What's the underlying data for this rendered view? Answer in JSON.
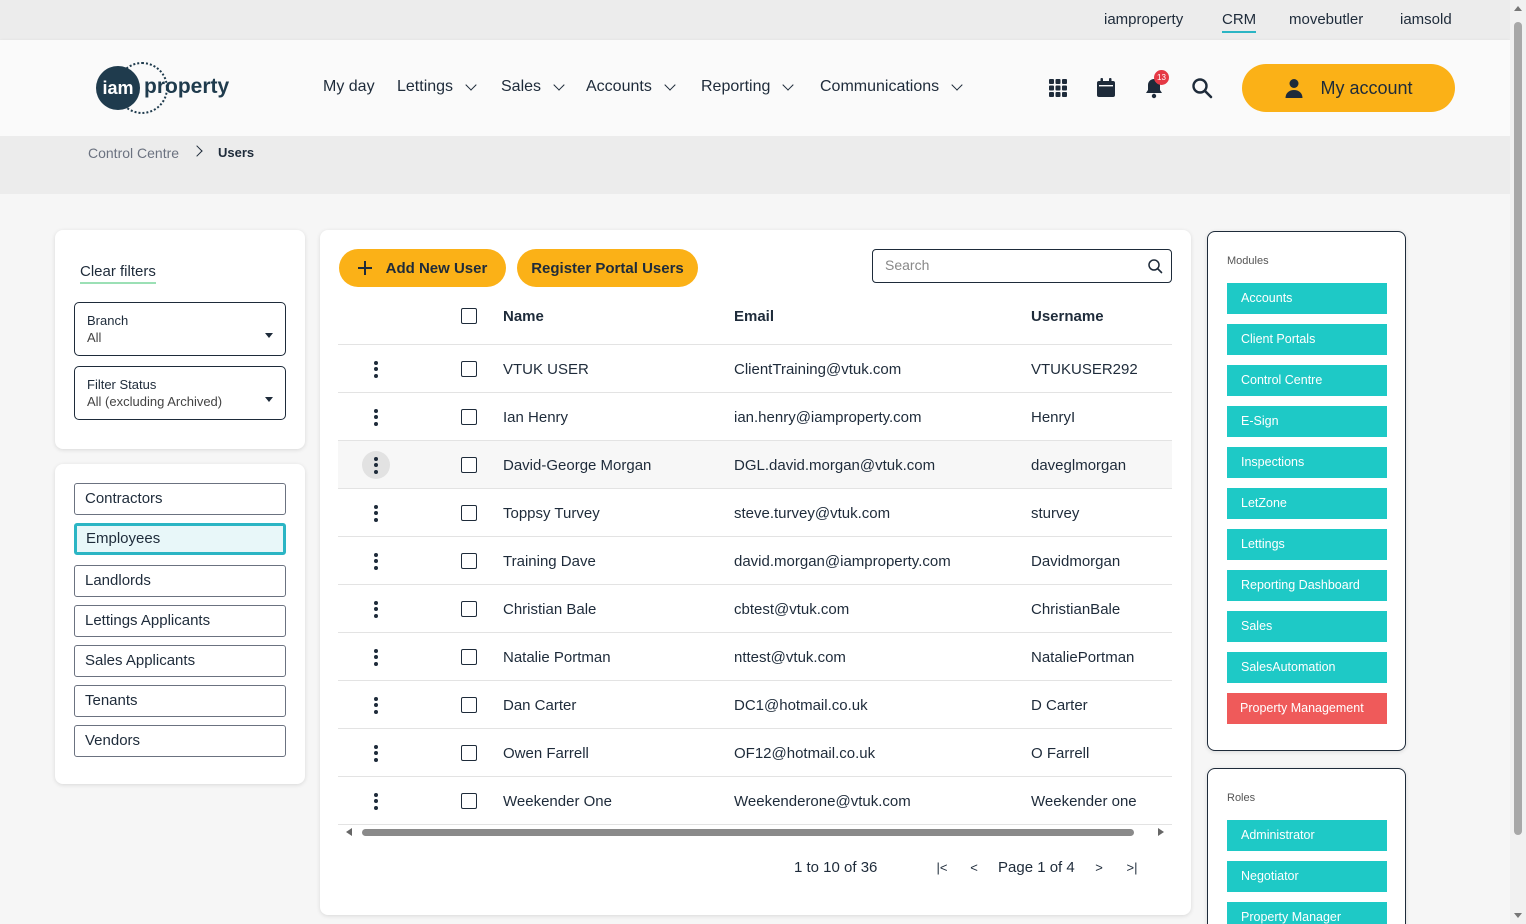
{
  "topbar": {
    "links": [
      "iamproperty",
      "CRM",
      "movebutler",
      "iamsold"
    ],
    "active": "CRM"
  },
  "logo": {
    "mark": "iam",
    "text": "property"
  },
  "nav": {
    "items": [
      "My day",
      "Lettings",
      "Sales",
      "Accounts",
      "Reporting",
      "Communications"
    ]
  },
  "header_icons": {
    "apps": "grid-icon",
    "calendar": "calendar-icon",
    "notifications": "bell-icon",
    "notification_count": "13",
    "search": "search-icon"
  },
  "account": {
    "label": "My account"
  },
  "breadcrumb": {
    "parent": "Control Centre",
    "current": "Users"
  },
  "filters": {
    "clear_label": "Clear filters",
    "branch": {
      "label": "Branch",
      "value": "All"
    },
    "status": {
      "label": "Filter Status",
      "value": "All (excluding Archived)"
    }
  },
  "user_types": [
    "Contractors",
    "Employees",
    "Landlords",
    "Lettings Applicants",
    "Sales Applicants",
    "Tenants",
    "Vendors"
  ],
  "selected_user_type": "Employees",
  "actions": {
    "add_user": "Add New User",
    "register_portal": "Register Portal Users"
  },
  "search": {
    "placeholder": "Search"
  },
  "table": {
    "columns": {
      "name": "Name",
      "email": "Email",
      "username": "Username"
    },
    "rows": [
      {
        "name": "VTUK USER",
        "email": "ClientTraining@vtuk.com",
        "username": "VTUKUSER292"
      },
      {
        "name": "Ian Henry",
        "email": "ian.henry@iamproperty.com",
        "username": "HenryI"
      },
      {
        "name": "David-George Morgan",
        "email": "DGL.david.morgan@vtuk.com",
        "username": "daveglmorgan"
      },
      {
        "name": "Toppsy Turvey",
        "email": "steve.turvey@vtuk.com",
        "username": "sturvey"
      },
      {
        "name": "Training Dave",
        "email": "david.morgan@iamproperty.com",
        "username": "Davidmorgan"
      },
      {
        "name": "Christian Bale",
        "email": "cbtest@vtuk.com",
        "username": "ChristianBale"
      },
      {
        "name": "Natalie Portman",
        "email": "nttest@vtuk.com",
        "username": "NataliePortman"
      },
      {
        "name": "Dan Carter",
        "email": "DC1@hotmail.co.uk",
        "username": "D Carter"
      },
      {
        "name": "Owen Farrell",
        "email": "OF12@hotmail.co.uk",
        "username": "O Farrell"
      },
      {
        "name": "Weekender One",
        "email": "Weekenderone@vtuk.com",
        "username": "Weekender one"
      }
    ]
  },
  "pagination": {
    "range": "1 to 10 of 36",
    "page": "Page 1 of 4"
  },
  "modules": {
    "title": "Modules",
    "items": [
      "Accounts",
      "Client Portals",
      "Control Centre",
      "E-Sign",
      "Inspections",
      "LetZone",
      "Lettings",
      "Reporting Dashboard",
      "Sales",
      "SalesAutomation",
      "Property Management"
    ]
  },
  "roles": {
    "title": "Roles",
    "items": [
      "Administrator",
      "Negotiator",
      "Property Manager"
    ]
  },
  "colors": {
    "accent_yellow": "#fbb117",
    "module_teal": "#1ec9c6",
    "module_red": "#ef5a5a",
    "active_border": "#2bb5c4",
    "navy": "#1e2b3a"
  }
}
